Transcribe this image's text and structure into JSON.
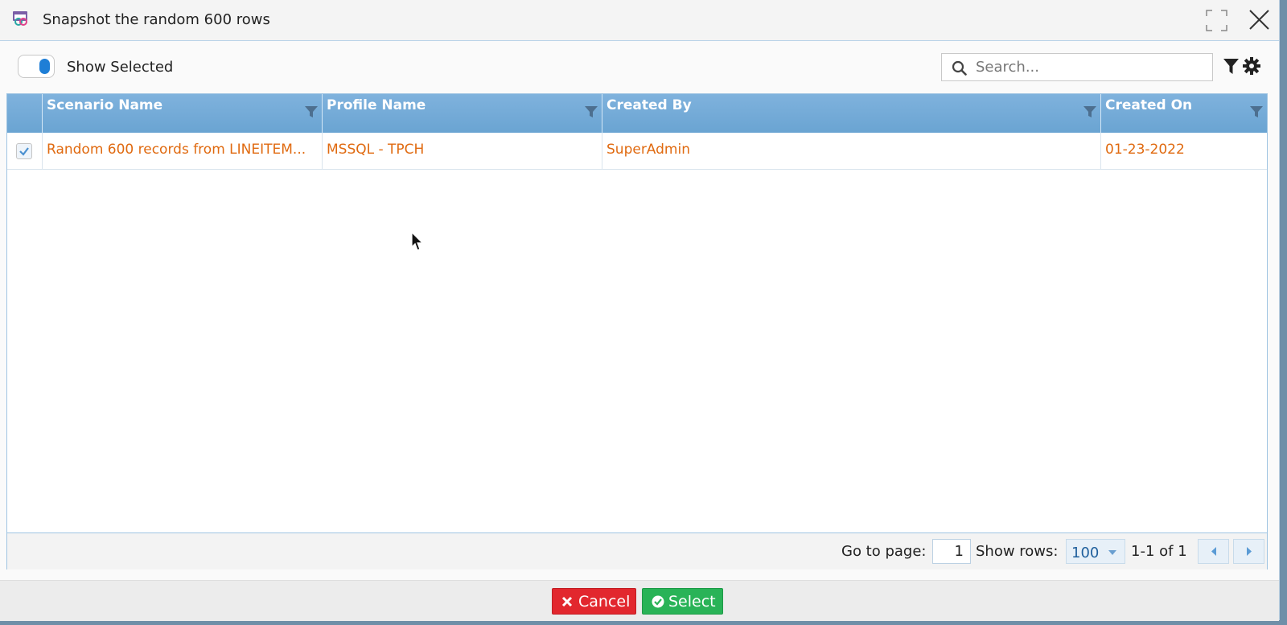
{
  "dialog": {
    "title": "Snapshot the random 600 rows",
    "icons": {
      "app": "snapshot-link-icon",
      "maximize": "maximize-icon",
      "close": "close-icon"
    }
  },
  "toolbar": {
    "show_selected_label": "Show Selected",
    "show_selected_on": true,
    "search_placeholder": "Search...",
    "search_value": "",
    "icons": [
      "search-icon",
      "filter-icon",
      "settings-icon"
    ]
  },
  "grid": {
    "columns": [
      {
        "label": "Scenario Name"
      },
      {
        "label": "Profile Name"
      },
      {
        "label": "Created By"
      },
      {
        "label": "Created On"
      }
    ],
    "rows": [
      {
        "selected": true,
        "scenario_name": "Random 600 records from LINEITEM...",
        "profile_name": "MSSQL - TPCH",
        "created_by": "SuperAdmin",
        "created_on": "01-23-2022"
      }
    ]
  },
  "pager": {
    "go_to_page_label": "Go to page:",
    "page": "1",
    "show_rows_label": "Show rows:",
    "rows_per_page": "100",
    "range": "1-1 of 1"
  },
  "actions": {
    "cancel_label": "Cancel",
    "select_label": "Select"
  },
  "colors": {
    "header_blue": "#7fb2dd",
    "link_orange": "#e06a10",
    "cancel_red": "#e2272e",
    "select_green": "#29b357",
    "toggle_blue": "#1e7ed6"
  }
}
